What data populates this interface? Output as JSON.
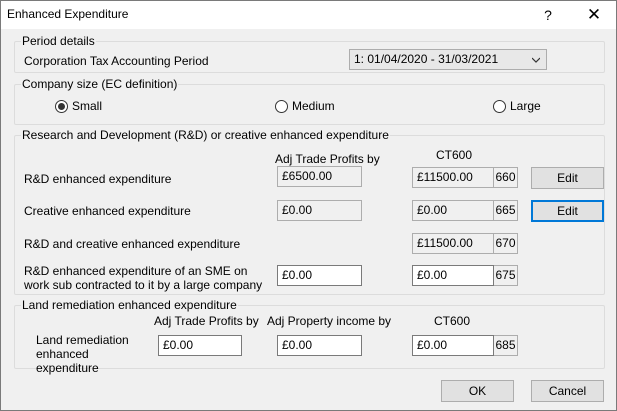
{
  "window": {
    "title": "Enhanced Expenditure",
    "help": "?",
    "close": "✕"
  },
  "period": {
    "group_label": "Period details",
    "label": "Corporation Tax Accounting Period",
    "selected": "1: 01/04/2020 - 31/03/2021"
  },
  "company_size": {
    "group_label": "Company size (EC definition)",
    "options": [
      "Small",
      "Medium",
      "Large"
    ],
    "selected": "Small"
  },
  "rd": {
    "group_label": "Research and Development (R&D) or creative enhanced expenditure",
    "col_adj": "Adj Trade Profits by",
    "col_ct600": "CT600",
    "rows": [
      {
        "label": "R&D enhanced expenditure",
        "adj": "£6500.00",
        "ct600": "£11500.00",
        "box": "660",
        "edit": "Edit"
      },
      {
        "label": "Creative enhanced expenditure",
        "adj": "£0.00",
        "ct600": "£0.00",
        "box": "665",
        "edit": "Edit"
      },
      {
        "label": "R&D and creative enhanced expenditure",
        "ct600": "£11500.00",
        "box": "670"
      },
      {
        "label": "R&D enhanced expenditure of an SME on work sub contracted to it by a large company",
        "adj": "£0.00",
        "ct600": "£0.00",
        "box": "675"
      }
    ]
  },
  "land": {
    "group_label": "Land remediation enhanced expenditure",
    "col_adj_trade": "Adj Trade Profits by",
    "col_adj_property": "Adj Property income by",
    "col_ct600": "CT600",
    "label": "Land remediation enhanced expenditure",
    "adj_trade": "£0.00",
    "adj_property": "£0.00",
    "ct600": "£0.00",
    "box": "685"
  },
  "buttons": {
    "ok": "OK",
    "cancel": "Cancel"
  }
}
